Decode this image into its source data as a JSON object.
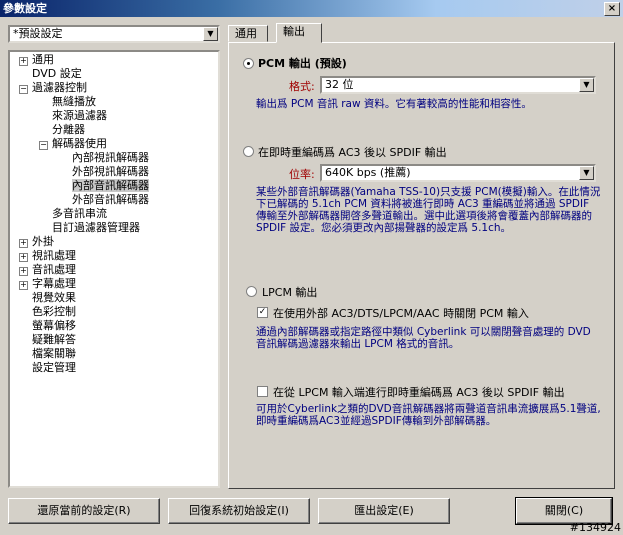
{
  "window": {
    "title": "參數設定",
    "close": "×"
  },
  "preset": {
    "value": "*預設設定"
  },
  "tree": {
    "items": [
      "通用",
      "DVD 設定",
      "過濾器控制",
      "無縫播放",
      "來源過濾器",
      "分離器",
      "解碼器使用",
      "內部視訊解碼器",
      "外部視訊解碼器",
      "內部音訊解碼器",
      "外部音訊解碼器",
      "多音訊串流",
      "目訂過濾器管理器",
      "外掛",
      "視訊處理",
      "音訊處理",
      "字幕處理",
      "視覺效果",
      "色彩控制",
      "螢幕偏移",
      "疑難解答",
      "檔案關聯",
      "設定管理"
    ]
  },
  "tabs": [
    "通用",
    "輸出"
  ],
  "pcm": {
    "label": "PCM 輸出 (預設)",
    "format_label": "格式:",
    "format_value": "32 位",
    "desc": "輸出爲 PCM 音訊 raw 資料。它有著較高的性能和相容性。"
  },
  "ac3": {
    "label": "在即時重編碼爲 AC3 後以 SPDIF 輸出",
    "bitrate_label": "位率:",
    "bitrate_value": "640K bps (推薦)",
    "desc": "某些外部音訊解碼器(Yamaha TSS-10)只支援 PCM(模擬)輸入。在此情況下已解碼的 5.1ch PCM 資料將被進行即時 AC3 重編碼並將通過 SPDIF 傳輸至外部解碼器開啓多聲道輸出。選中此選項後將會覆蓋內部解碼器的 SPDIF 設定。您必須更改內部揚聲器的設定爲 5.1ch。"
  },
  "lpcm": {
    "label": "LPCM 輸出",
    "check1_label": "在使用外部 AC3/DTS/LPCM/AAC 時關閉 PCM 輸入",
    "desc1": "通過內部解碼器或指定路徑中類似 Cyberlink 可以關閉聲音處理的 DVD 音訊解碼過濾器來輸出 LPCM 格式的音訊。",
    "check2_label": "在從 LPCM 輸入端進行即時重編碼爲 AC3 後以 SPDIF 輸出",
    "desc2": "可用於Cyberlink之類的DVD音訊解碼器將兩聲道音訊串流擴展爲5.1聲道, 即時重編碼爲AC3並經過SPDIF傳輸到外部解碼器。"
  },
  "buttons": {
    "restore": "還原當前的設定(R)",
    "reset": "回復系統初始設定(I)",
    "export": "匯出設定(E)",
    "close": "關閉(C)"
  },
  "watermark": "#134924"
}
